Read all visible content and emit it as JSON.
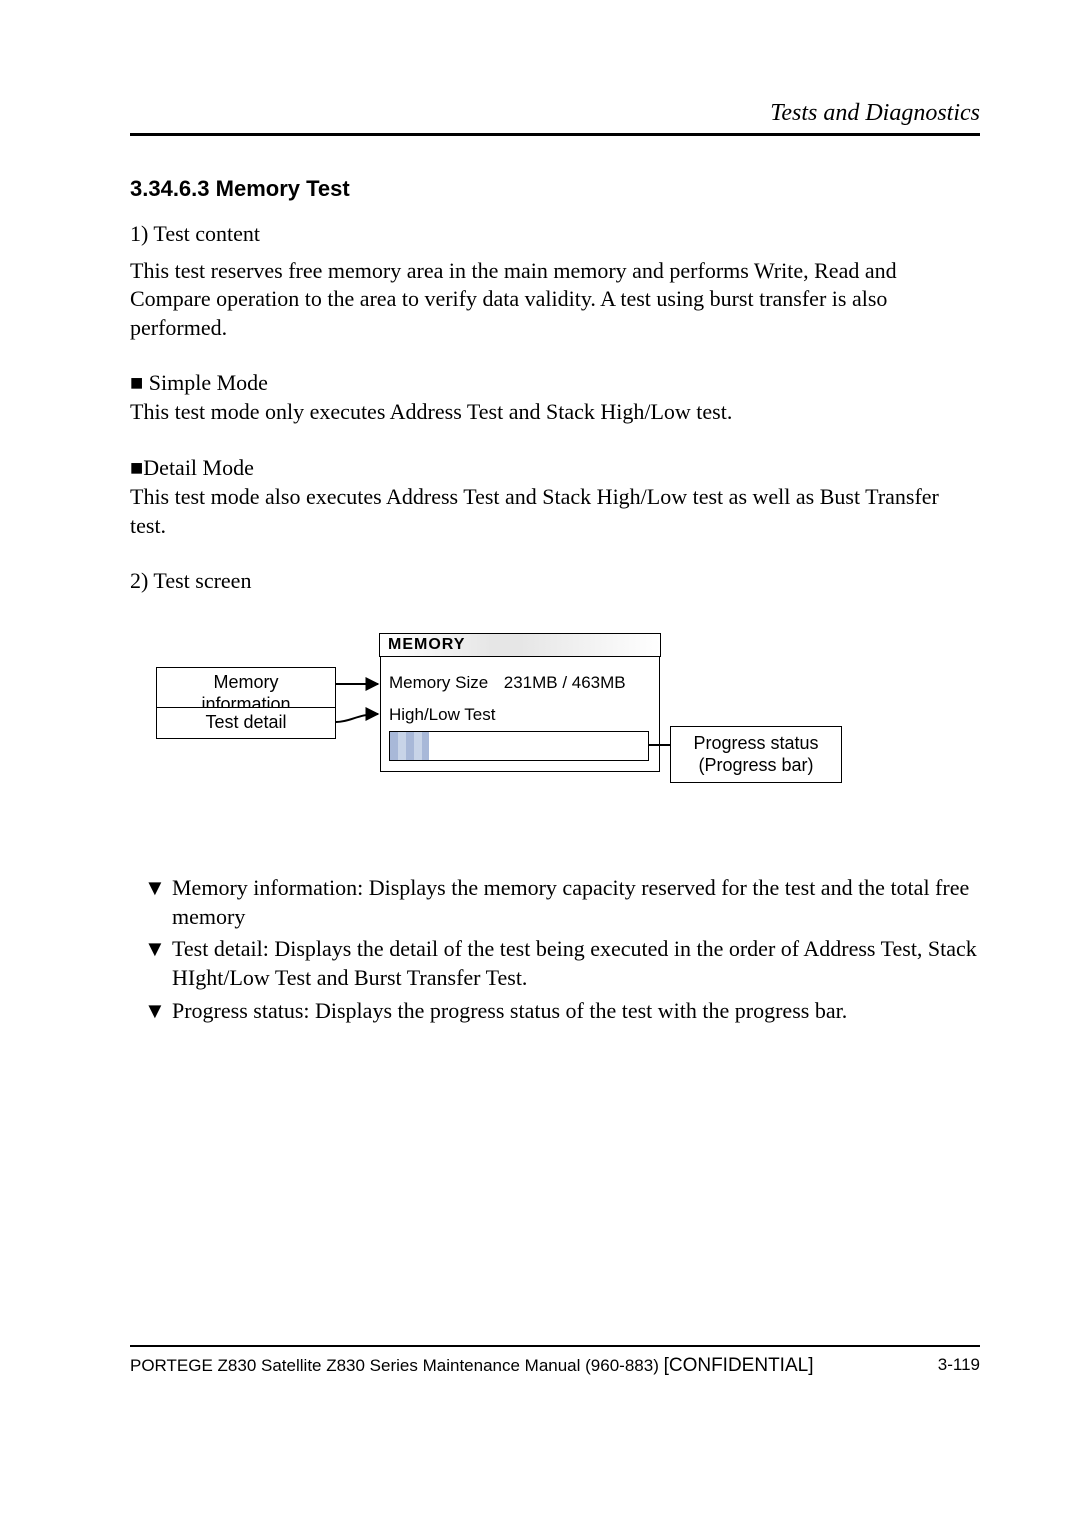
{
  "header": {
    "chapter_title": "Tests and Diagnostics"
  },
  "section": {
    "number_title": "3.34.6.3  Memory Test",
    "p1_label": "1) Test content",
    "p1_text": "This test reserves free memory area in the main memory and performs Write, Read and Compare operation to the area to verify data validity. A test using burst transfer is also performed.",
    "simple_label": "■ Simple Mode",
    "simple_text": "This test mode only executes Address Test and Stack High/Low test.",
    "detail_label": "■Detail Mode",
    "detail_text": "This test mode also executes Address Test and Stack High/Low test as well as Bust Transfer test.",
    "p2_label": "2) Test screen"
  },
  "diagram": {
    "callout_memory_info": "Memory information",
    "callout_test_detail": "Test detail",
    "callout_progress_line1": "Progress status",
    "callout_progress_line2": "(Progress bar)",
    "panel_title": "MEMORY",
    "memsize_label": "Memory Size",
    "memsize_value": "231MB / 463MB",
    "highlow_label": "High/Low Test",
    "progress_percent": 15
  },
  "list": {
    "item1": "Memory information: Displays the memory capacity reserved for the test and the total free memory",
    "item2": "Test detail: Displays the detail of the test being executed in the order of Address Test, Stack HIght/Low Test and Burst Transfer Test.",
    "item3": "Progress status: Displays the progress status of the test with the progress bar."
  },
  "footer": {
    "manual": "PORTEGE Z830 Satellite Z830 Series Maintenance Manual (960-883) ",
    "confidential": "[CONFIDENTIAL]",
    "page": "3-119"
  },
  "glyphs": {
    "down_triangle": "▼"
  }
}
